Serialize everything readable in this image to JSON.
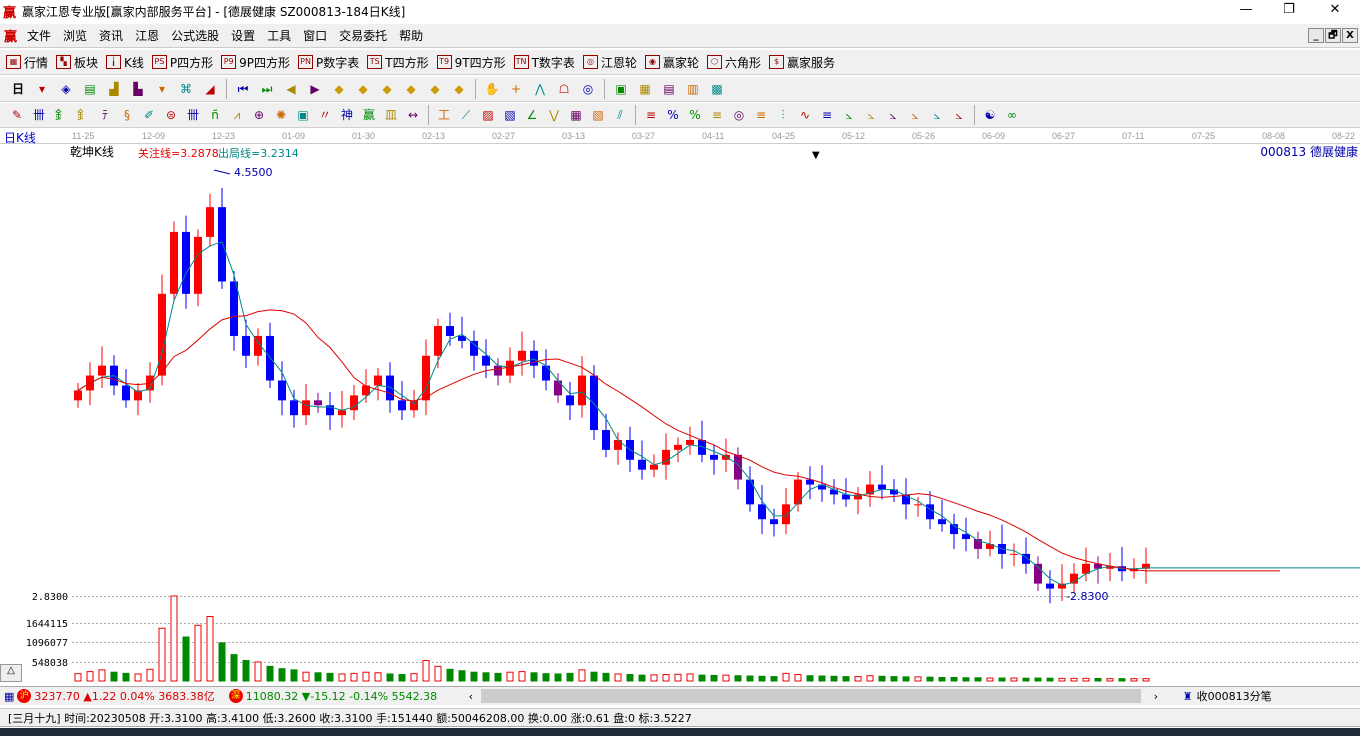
{
  "window": {
    "title": "赢家江恩专业版[赢家内部服务平台] - [德展健康  SZ000813-184日K线]",
    "logo": "赢",
    "minimize": "—",
    "restore": "❐",
    "close": "✕"
  },
  "menu": [
    "文件",
    "浏览",
    "资讯",
    "江恩",
    "公式选股",
    "设置",
    "工具",
    "窗口",
    "交易委托",
    "帮助"
  ],
  "mdi_buttons": [
    "_",
    "🗗",
    "X"
  ],
  "toolbar1": [
    {
      "icon": "quotes-table",
      "glyph": "▦",
      "label": "行情"
    },
    {
      "icon": "sector-blocks",
      "glyph": "▚",
      "label": "板块"
    },
    {
      "icon": "kline",
      "glyph": "╽",
      "label": "K线"
    },
    {
      "icon": "ps",
      "glyph": "PS",
      "label": "P四方形"
    },
    {
      "icon": "p9",
      "glyph": "P9",
      "label": "9P四方形"
    },
    {
      "icon": "pn",
      "glyph": "PN",
      "label": "P数字表"
    },
    {
      "icon": "ts",
      "glyph": "TS",
      "label": "T四方形"
    },
    {
      "icon": "t9",
      "glyph": "T9",
      "label": "9T四方形"
    },
    {
      "icon": "tn",
      "glyph": "TN",
      "label": "T数字表"
    },
    {
      "icon": "gann-wheel",
      "glyph": "◎",
      "label": "江恩轮"
    },
    {
      "icon": "winner-wheel",
      "glyph": "◉",
      "label": "赢家轮"
    },
    {
      "icon": "hexagon",
      "glyph": "⬡",
      "label": "六角形"
    },
    {
      "icon": "dollar",
      "glyph": "$",
      "label": "赢家服务"
    }
  ],
  "toolbar2": {
    "period": "日",
    "icons": [
      "period-dropdown",
      "flow-chart",
      "document",
      "bars3",
      "bars9",
      "candle-dropdown",
      "formula",
      "pyramid",
      "first-page",
      "last-page",
      "arrow-left",
      "arrow-right",
      "diamond-left",
      "diamond-right",
      "diamond-lr",
      "diamond-x",
      "diamond-cross",
      "diamond-all",
      "hand",
      "crosshair",
      "draw-line",
      "pattern",
      "cycle",
      "calendar",
      "calculator",
      "report",
      "save",
      "network"
    ]
  },
  "toolbar3": {
    "icons": [
      "pen",
      "grid-lines",
      "gold-1",
      "gold-2",
      "fib-t",
      "spiral",
      "pen-2",
      "circle-grid",
      "hash-lines",
      "n2",
      "angle",
      "target",
      "radar",
      "square-spiral",
      "parallel",
      "shen",
      "ying",
      "comb",
      "measure",
      "frame",
      "fan",
      "box-fan",
      "box-fan-2",
      "angle-lines",
      "zigzag",
      "grid-red",
      "grid-diag",
      "slant-lines",
      "list",
      "pct-box",
      "percent",
      "pct-lines",
      "gold-circle",
      "gold-lines",
      "tower",
      "wave",
      "gold-bar",
      "j-angle",
      "f-angle",
      "gold-angle",
      "shen-angle",
      "ying-angle",
      "four-angle",
      "yin-yang",
      "infinity"
    ]
  },
  "chart": {
    "period_label": "日K线",
    "indicator_name": "乾坤K线",
    "focus_line": "关注线=3.2878",
    "exit_line": "出局线=3.2314",
    "stock_label": "000813  德展健康",
    "high_label": "4.5500",
    "low_label": "2.8300",
    "dates": [
      "11-25",
      "12-09",
      "12-23",
      "01-09",
      "01-30",
      "02-13",
      "02-27",
      "03-13",
      "03-27",
      "04-11",
      "04-25",
      "05-12",
      "05-26",
      "06-09",
      "06-27",
      "07-11",
      "07-25",
      "08-08",
      "08-22"
    ],
    "volume_axis": [
      "2.8300",
      "1644115",
      "1096077",
      "548038"
    ]
  },
  "chart_data": {
    "type": "candlestick",
    "ylim": [
      2.83,
      4.55
    ],
    "volume_max": 2900000,
    "close": [
      3.66,
      3.72,
      3.76,
      3.68,
      3.62,
      3.66,
      3.72,
      4.05,
      4.3,
      4.05,
      4.28,
      4.4,
      4.1,
      3.88,
      3.8,
      3.88,
      3.7,
      3.62,
      3.56,
      3.62,
      3.6,
      3.56,
      3.58,
      3.64,
      3.68,
      3.72,
      3.62,
      3.58,
      3.62,
      3.8,
      3.92,
      3.88,
      3.86,
      3.8,
      3.76,
      3.72,
      3.78,
      3.82,
      3.76,
      3.7,
      3.64,
      3.6,
      3.72,
      3.5,
      3.42,
      3.46,
      3.38,
      3.34,
      3.36,
      3.42,
      3.44,
      3.46,
      3.4,
      3.38,
      3.4,
      3.3,
      3.2,
      3.14,
      3.12,
      3.2,
      3.3,
      3.28,
      3.26,
      3.24,
      3.22,
      3.24,
      3.28,
      3.26,
      3.24,
      3.2,
      3.2,
      3.14,
      3.12,
      3.08,
      3.06,
      3.02,
      3.04,
      3.0,
      3.0,
      2.96,
      2.88,
      2.86,
      2.88,
      2.92,
      2.96,
      2.94,
      2.95,
      2.93,
      2.94,
      2.96
    ],
    "volume": [
      250000,
      320000,
      380000,
      300000,
      260000,
      240000,
      400000,
      1800000,
      2900000,
      1500000,
      1900000,
      2200000,
      1300000,
      900000,
      700000,
      650000,
      500000,
      420000,
      380000,
      300000,
      280000,
      260000,
      240000,
      260000,
      300000,
      280000,
      240000,
      220000,
      250000,
      700000,
      500000,
      400000,
      350000,
      300000,
      280000,
      260000,
      300000,
      320000,
      280000,
      250000,
      240000,
      260000,
      380000,
      300000,
      260000,
      240000,
      220000,
      200000,
      210000,
      220000,
      230000,
      240000,
      200000,
      190000,
      200000,
      180000,
      170000,
      160000,
      150000,
      260000,
      220000,
      180000,
      170000,
      160000,
      150000,
      150000,
      180000,
      160000,
      150000,
      140000,
      140000,
      130000,
      120000,
      120000,
      110000,
      110000,
      100000,
      100000,
      100000,
      95000,
      100000,
      95000,
      90000,
      90000,
      90000,
      85000,
      80000,
      80000,
      80000,
      80000
    ]
  },
  "status": {
    "sh_badge": "沪",
    "sh_text": "3237.70 ▲1.22 0.04% 3683.38亿",
    "sz_badge": "深",
    "sz_text": "11080.32 ▼-15.12 -0.14% 5542.38",
    "scroll_left": "‹",
    "scroll_right": "›",
    "right_text": "收000813分笔"
  },
  "info": {
    "text": "[三月十九] 时间:20230508 开:3.3100 高:3.4100 低:3.2600 收:3.3100 手:151440 额:50046208.00 换:0.00 涨:0.61 盘:0 标:3.5227"
  }
}
